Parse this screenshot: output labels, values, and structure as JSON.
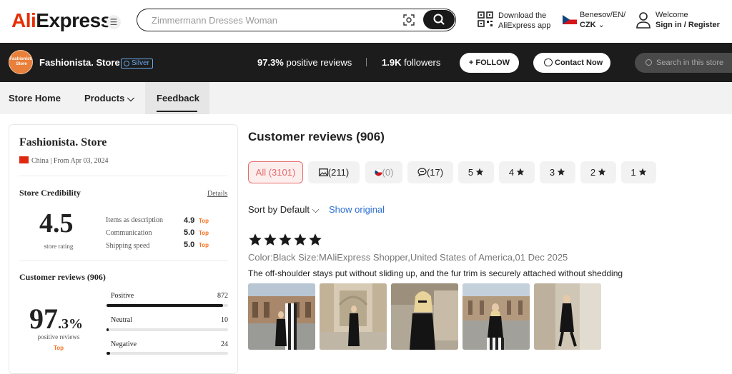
{
  "header": {
    "logo_ali": "Ali",
    "logo_express": "Express",
    "search_placeholder": "Zimmermann Dresses Woman",
    "download_line1": "Download the",
    "download_line2": "AliExpress app",
    "locale_line1": "Benesov/EN/",
    "locale_currency": "CZK",
    "welcome": "Welcome",
    "sign_in": "Sign in / Register"
  },
  "store": {
    "avatar_text": "Fashionista Store",
    "name": "Fashionista. Store",
    "badge": "Silver",
    "positive_value": "97.3%",
    "positive_label": "positive reviews",
    "followers_value": "1.9K",
    "followers_label": "followers",
    "follow_label": "+ FOLLOW",
    "contact_label": "Contact Now",
    "search_placeholder": "Search in this store"
  },
  "nav": {
    "store_home": "Store Home",
    "products": "Products",
    "feedback": "Feedback"
  },
  "card": {
    "title": "Fashionista. Store",
    "origin": "China | From Apr 03, 2024",
    "credibility_title": "Store Credibility",
    "details": "Details",
    "rating": "4.5",
    "rating_label": "store rating",
    "metrics": [
      {
        "label": "Items as description",
        "value": "4.9",
        "tag": "Top"
      },
      {
        "label": "Communication",
        "value": "5.0",
        "tag": "Top"
      },
      {
        "label": "Shipping speed",
        "value": "5.0",
        "tag": "Top"
      }
    ],
    "reviews_title": "Customer reviews (906)",
    "pct_big": "97",
    "pct_small": ".3%",
    "pct_label": "positive reviews",
    "pct_tag": "Top",
    "breakdown": [
      {
        "label": "Positive",
        "count": "872",
        "fraction": 0.96
      },
      {
        "label": "Neutral",
        "count": "10",
        "fraction": 0.01
      },
      {
        "label": "Negative",
        "count": "24",
        "fraction": 0.03
      }
    ]
  },
  "reviews": {
    "title": "Customer reviews (906)",
    "filters": {
      "all": "All (3101)",
      "photos": "(211)",
      "local": "(0)",
      "comments": "(17)",
      "s5": "5",
      "s4": "4",
      "s3": "3",
      "s2": "2",
      "s1": "1"
    },
    "sort_label": "Sort by Default",
    "show_original": "Show original",
    "item": {
      "stars": 5,
      "meta": "Color:Black Size:MAliExpress Shopper,United States of America,01 Dec 2025",
      "text": "The off-shoulder stays put without sliding up, and the fur trim is securely attached without shedding"
    }
  },
  "colors": {
    "brand_red": "#e62e04",
    "store_bar": "#1c1c1c",
    "link_blue": "#2d6fd1",
    "top_orange": "#f57224",
    "chip_active": "#e46b6b"
  }
}
